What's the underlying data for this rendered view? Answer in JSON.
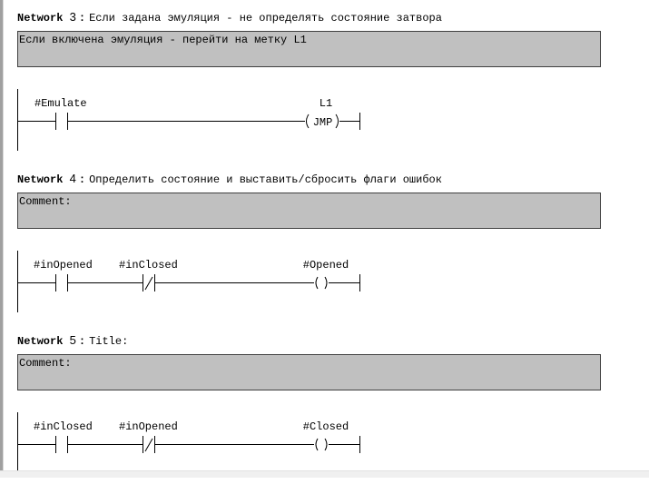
{
  "networks": [
    {
      "label": "Network",
      "number": "3",
      "title": "Если задана эмуляция - не определять состояние затвора",
      "comment": "Если включена эмуляция - перейти на метку L1",
      "contacts": [
        {
          "operand": "#Emulate",
          "type": "normally-open"
        }
      ],
      "coil": {
        "operand": "L1",
        "type": "jump",
        "text": "JMP"
      }
    },
    {
      "label": "Network",
      "number": "4",
      "title": "Определить состояние и выставить/сбросить флаги ошибок",
      "comment": "Comment:",
      "contacts": [
        {
          "operand": "#inOpened",
          "type": "normally-open"
        },
        {
          "operand": "#inClosed",
          "type": "normally-closed"
        }
      ],
      "coil": {
        "operand": "#Opened",
        "type": "output",
        "text": ""
      }
    },
    {
      "label": "Network",
      "number": "5",
      "title": "Title:",
      "comment": "Comment:",
      "contacts": [
        {
          "operand": "#inClosed",
          "type": "normally-open"
        },
        {
          "operand": "#inOpened",
          "type": "normally-closed"
        }
      ],
      "coil": {
        "operand": "#Closed",
        "type": "output",
        "text": ""
      }
    }
  ],
  "colors": {
    "comment_bg": "#c0c0c0",
    "wire": "#000000"
  }
}
